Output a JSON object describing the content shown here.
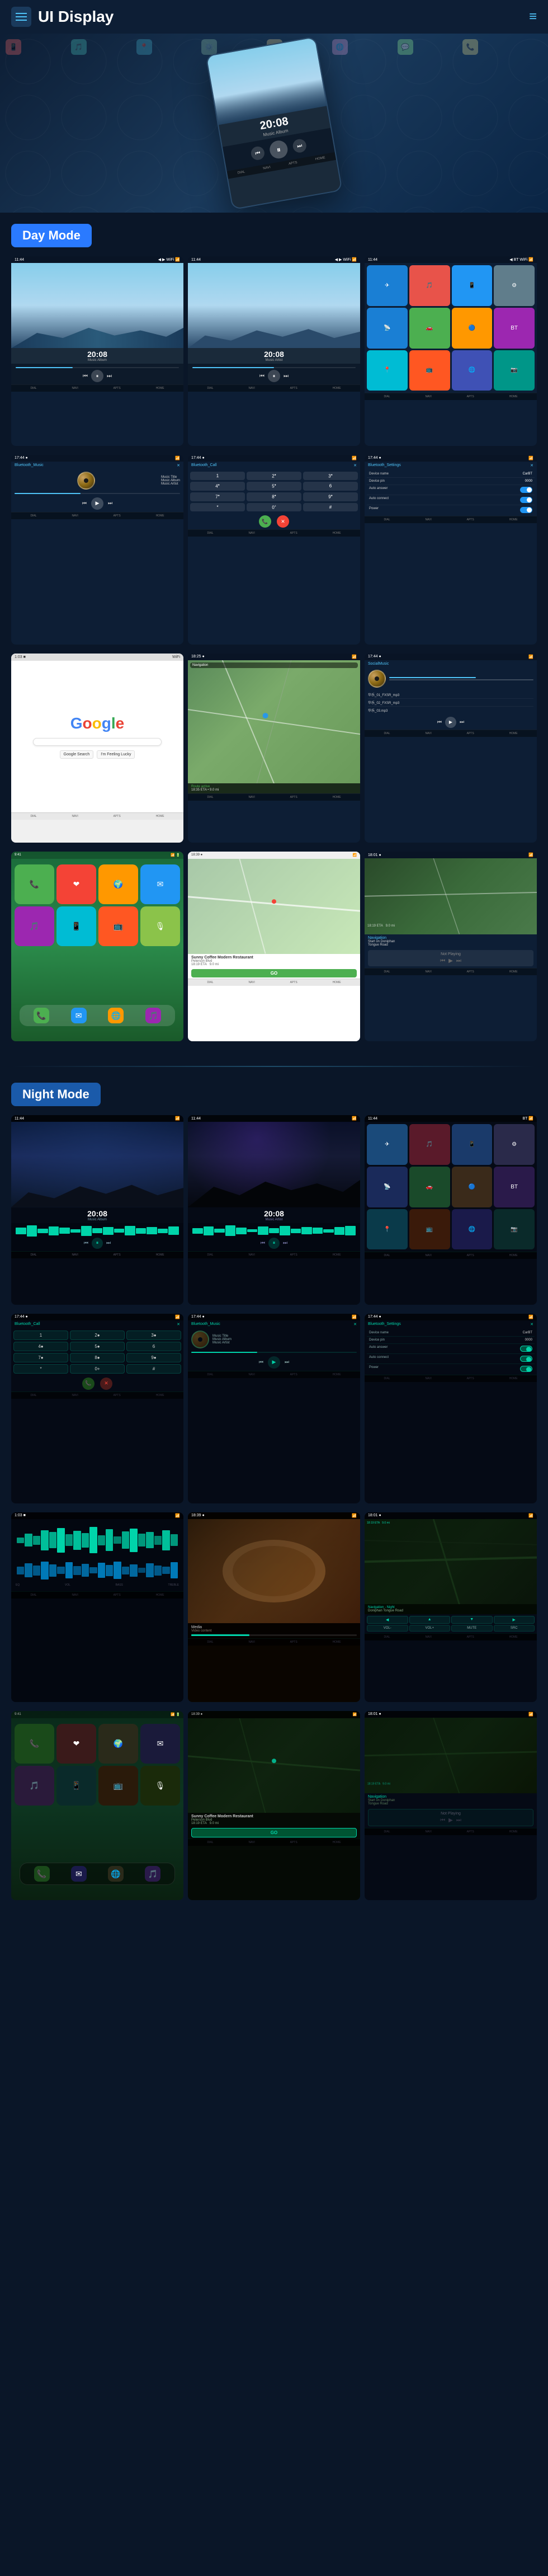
{
  "header": {
    "title": "UI Display",
    "menu_icon": "☰",
    "dots_icon": "⋮"
  },
  "day_mode": {
    "label": "Day Mode"
  },
  "night_mode": {
    "label": "Night Mode"
  },
  "music": {
    "time": "20:08",
    "title": "Music Title",
    "album": "Music Album",
    "artist": "Music Artist"
  },
  "hero": {
    "time": "20:08"
  },
  "bottom_nav": {
    "items": [
      "DIAL",
      "NAVI",
      "APTS",
      "HOME"
    ]
  },
  "google": {
    "text": "Google"
  },
  "settings": {
    "rows": [
      {
        "label": "Device name",
        "value": "CarBT"
      },
      {
        "label": "Device pin",
        "value": "0000"
      },
      {
        "label": "Auto answer",
        "value": "toggle"
      },
      {
        "label": "Auto connect",
        "value": "toggle"
      },
      {
        "label": "Power",
        "value": "toggle"
      }
    ]
  },
  "restaurant": {
    "name": "Sunny Coffee Modern Restaurant",
    "address": "Peterson Blvd",
    "time_label": "18:19 ETA",
    "distance": "9.0 mi",
    "go_label": "GO"
  },
  "not_playing": {
    "label": "Not Playing",
    "route": "Start on Doniphan Tongue Road",
    "eta_label": "18:19 ETA",
    "distance": "9.0 mi"
  },
  "local_music": {
    "files": [
      "华乐_01_FXSR_mp3",
      "华乐_02_FXSR_mp3",
      "华乐_03.mp3"
    ]
  },
  "dialpad": {
    "buttons": [
      "1",
      "2●",
      "3●",
      "4●",
      "5●",
      "6●",
      "7●",
      "8●",
      "9●",
      "*",
      "0+",
      "#"
    ]
  },
  "waveform": {
    "bars": [
      15,
      22,
      18,
      30,
      25,
      12,
      28,
      20,
      35,
      18,
      22,
      28,
      15,
      24,
      30,
      18,
      22
    ]
  }
}
